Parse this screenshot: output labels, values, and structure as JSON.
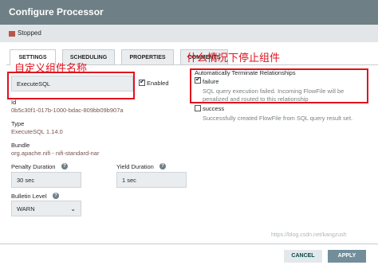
{
  "window": {
    "title": "Configure Processor"
  },
  "status": {
    "text": "Stopped",
    "color": "#ba554a"
  },
  "tabs": [
    {
      "label": "SETTINGS",
      "active": true
    },
    {
      "label": "SCHEDULING",
      "active": false
    },
    {
      "label": "PROPERTIES",
      "active": false
    },
    {
      "label": "COMMENTS",
      "active": false
    }
  ],
  "settings": {
    "name_value": "ExecuteSQL",
    "enabled_label": "Enabled",
    "enabled_checked": true,
    "id_label": "Id",
    "id_value": "0b5c30f1-017b-1000-bdac-809bb09b907a",
    "type_label": "Type",
    "type_value": "ExecuteSQL 1.14.0",
    "bundle_label": "Bundle",
    "bundle_value": "org.apache.nifi - nifi-standard-nar",
    "penalty_label": "Penalty Duration",
    "penalty_value": "30 sec",
    "yield_label": "Yield Duration",
    "yield_value": "1 sec",
    "bulletin_label": "Bulletin Level",
    "bulletin_value": "WARN"
  },
  "relationships": {
    "header": "Automatically Terminate Relationships",
    "items": [
      {
        "name": "failure",
        "checked": true,
        "description": "SQL query execution failed. Incoming FlowFile will be penalized and routed to this relationship"
      },
      {
        "name": "success",
        "checked": false,
        "description": "Successfully created FlowFile from SQL query result set."
      }
    ]
  },
  "annotations": {
    "name_note": "自定义组件名称",
    "terminate_note": "什么情况下停止组件",
    "color": "#e0121d"
  },
  "footer": {
    "cancel_label": "CANCEL",
    "apply_label": "APPLY"
  },
  "watermark": "https://blog.csdn.net/kangzush"
}
